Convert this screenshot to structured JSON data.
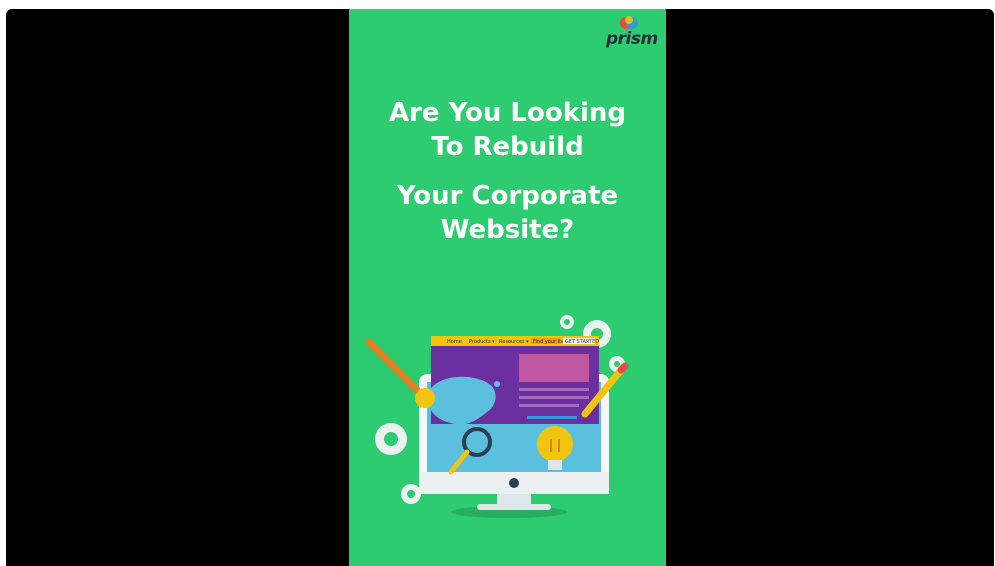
{
  "brand": {
    "name": "prism",
    "colors": {
      "background": "#2ecc71",
      "frame": "#000000",
      "headline": "#ffffff"
    }
  },
  "headline": {
    "line1": "Are You Looking",
    "line2": "To Rebuild",
    "line3": "Your Corporate",
    "line4": "Website?"
  },
  "illustration": {
    "nav": {
      "home": "Home",
      "products": "Products ▾",
      "resources": "Resources ▾",
      "search": "Find your item",
      "cta": "GET STARTED"
    }
  }
}
